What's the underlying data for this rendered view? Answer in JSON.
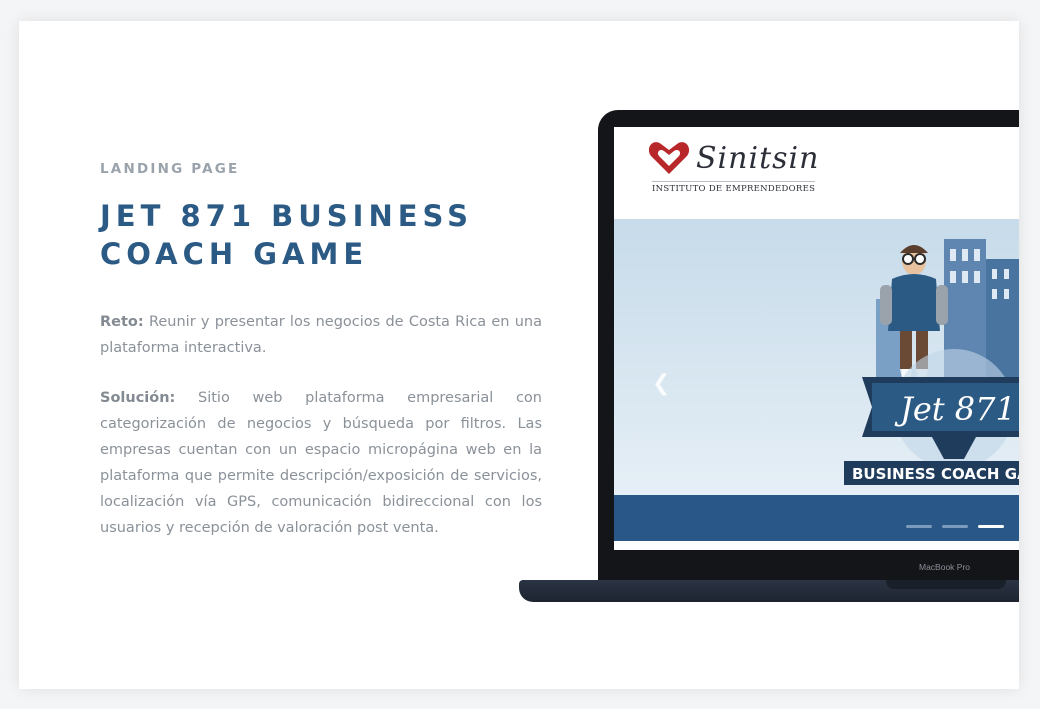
{
  "section": {
    "eyebrow": "LANDING PAGE",
    "title_line1": "JET 871 BUSINESS",
    "title_line2": "COACH GAME",
    "reto_label": "Reto:",
    "reto_text": " Reunir y presentar los negocios de Costa Rica en una plataforma interactiva.",
    "solucion_label": "Solución:",
    "solucion_text": " Sitio web plataforma empresarial con categorización de negocios y búsqueda por filtros. Las empresas cuentan con un espacio micropágina web en la plataforma que permite descripción/exposición de servicios, localización vía GPS, comunicación bidireccional con los usuarios y recepción de valoración post venta."
  },
  "mockup": {
    "device_label": "MacBook Pro",
    "site": {
      "logo_name": "Sinitsin",
      "logo_subtitle": "INSTITUTO DE EMPRENDEDORES",
      "hero_script": "Jet 871",
      "hero_banner": "BUSINESS COACH GA",
      "prev_icon": "chevron-left-icon"
    }
  },
  "colors": {
    "title": "#2b5a85",
    "body": "#8a9199",
    "eyebrow": "#9aa3ab",
    "site_banner": "#295888"
  }
}
